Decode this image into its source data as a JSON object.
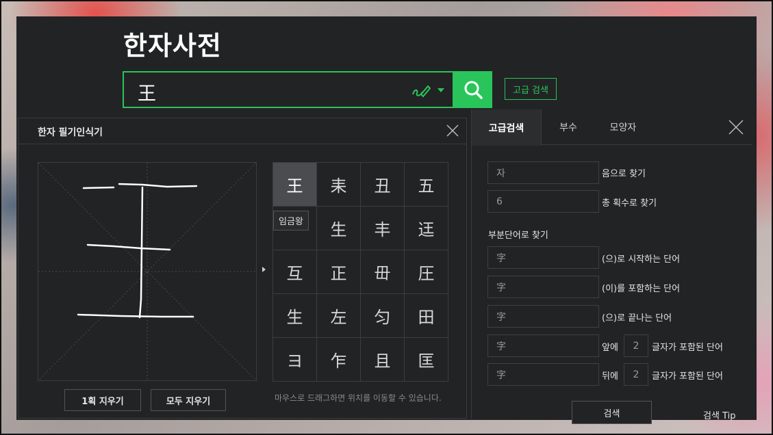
{
  "app": {
    "title": "한자사전"
  },
  "search": {
    "value": "王",
    "adv_link": "고급 검색"
  },
  "handwriting": {
    "title": "한자 필기인식기",
    "candidates": [
      "王",
      "耒",
      "丑",
      "五",
      "",
      "生",
      "丰",
      "迋",
      "互",
      "正",
      "毌",
      "圧",
      "生",
      "左",
      "匀",
      "田",
      "ヨ",
      "乍",
      "且",
      "匡"
    ],
    "tooltip": "임금왕",
    "clear_stroke": "1획 지우기",
    "clear_all": "모두 지우기",
    "hint": "마우스로 드래그하면 위치를 이동할 수 있습니다."
  },
  "advanced": {
    "tabs": [
      "고급검색",
      "부수",
      "모양자"
    ],
    "sound_value": "자",
    "sound_label": "음으로 찾기",
    "strokes_value": "6",
    "strokes_label": "총 획수로 찾기",
    "partial_title": "부분단어로 찾기",
    "rows": [
      {
        "value": "字",
        "label": "(으)로 시작하는 단어"
      },
      {
        "value": "字",
        "label": "(이)를 포함하는 단어"
      },
      {
        "value": "字",
        "label": "(으)로 끝나는 단어"
      }
    ],
    "front": {
      "value": "字",
      "prefix": "앞에",
      "count": "2",
      "suffix": "글자가 포함된 단어"
    },
    "back": {
      "value": "字",
      "prefix": "뒤에",
      "count": "2",
      "suffix": "글자가 포함된 단어"
    },
    "search_btn": "검색",
    "tip": "검색 Tip"
  },
  "colors": {
    "accent": "#2ac55a",
    "panel": "#222324"
  }
}
